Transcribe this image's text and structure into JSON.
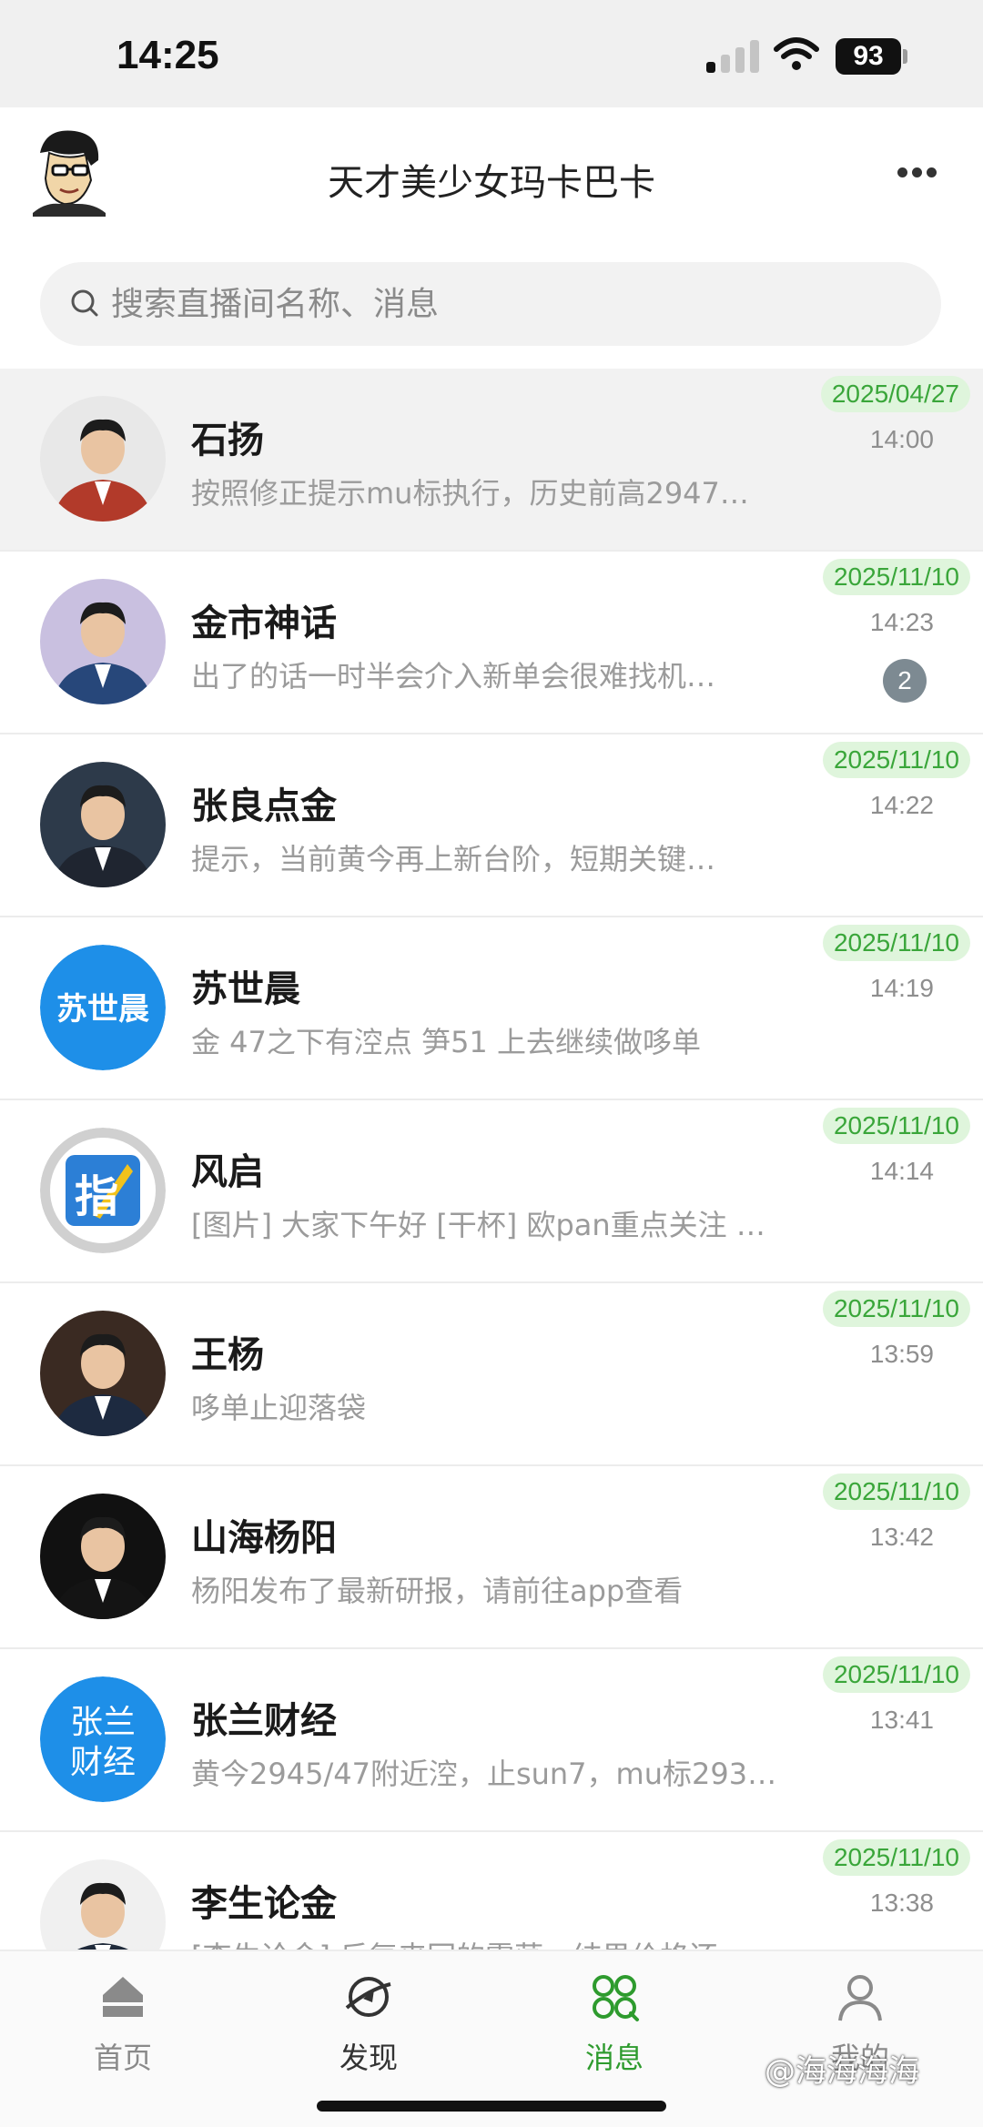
{
  "status_bar": {
    "time": "14:25",
    "battery": "93"
  },
  "header": {
    "title": "天才美少女玛卡巴卡"
  },
  "search": {
    "placeholder": "搜索直播间名称、消息"
  },
  "conversations": [
    {
      "name": "石扬",
      "message": "按照修正提示mu标执行，历史前高2947…",
      "date": "2025/04/27",
      "time": "14:00",
      "badge": "",
      "avatar_type": "photo",
      "avatar_colors": {
        "bg": "#e8e8e8",
        "body": "#b23a2a"
      }
    },
    {
      "name": "金市神话",
      "message": "出了的话一时半会介入新单会很难找机…",
      "date": "2025/11/10",
      "time": "14:23",
      "badge": "2",
      "avatar_type": "photo",
      "avatar_colors": {
        "bg": "#c9c0e0",
        "body": "#27477a"
      }
    },
    {
      "name": "张良点金",
      "message": "提示，当前黄今再上新台阶，短期关键…",
      "date": "2025/11/10",
      "time": "14:22",
      "badge": "",
      "avatar_type": "photo",
      "avatar_colors": {
        "bg": "#2d3a4a",
        "body": "#1f2530"
      }
    },
    {
      "name": "苏世晨",
      "message": "金 47之下有涳点 笋51 上去继续做哆单",
      "date": "2025/11/10",
      "time": "14:19",
      "badge": "",
      "avatar_type": "text",
      "avatar_text": "苏世晨",
      "avatar_colors": {
        "bg": "#1e8fe8",
        "body": "#ffffff"
      }
    },
    {
      "name": "风启",
      "message": "[图片] 大家下午好 [干杯] 欧pan重点关注 …",
      "date": "2025/11/10",
      "time": "14:14",
      "badge": "",
      "avatar_type": "logo",
      "avatar_text": "指",
      "avatar_colors": {
        "bg": "#2c7fd6",
        "body": "#f2c21b"
      }
    },
    {
      "name": "王杨",
      "message": "哆单止迎落袋",
      "date": "2025/11/10",
      "time": "13:59",
      "badge": "",
      "avatar_type": "photo",
      "avatar_colors": {
        "bg": "#3a2a22",
        "body": "#1d2a40"
      }
    },
    {
      "name": "山海杨阳",
      "message": "杨阳发布了最新研报，请前往app查看",
      "date": "2025/11/10",
      "time": "13:42",
      "badge": "",
      "avatar_type": "photo",
      "avatar_colors": {
        "bg": "#111111",
        "body": "#141414"
      }
    },
    {
      "name": "张兰财经",
      "message": "黄今2945/47附近涳，止sun7，mu标293…",
      "date": "2025/11/10",
      "time": "13:41",
      "badge": "",
      "avatar_type": "text2",
      "avatar_text": "张兰",
      "avatar_text2": "财经",
      "avatar_colors": {
        "bg": "#1e8fe8",
        "body": "#ffffff"
      }
    },
    {
      "name": "李生论金",
      "message": "[李生论金] 反复来回的震荡，结果价格还…",
      "date": "2025/11/10",
      "time": "13:38",
      "badge": "",
      "avatar_type": "photo",
      "avatar_colors": {
        "bg": "#f0f0f0",
        "body": "#1f2a3a"
      }
    }
  ],
  "tabs": [
    {
      "label": "首页",
      "icon": "home-icon",
      "state": "normal"
    },
    {
      "label": "发现",
      "icon": "discover-icon",
      "state": "dark"
    },
    {
      "label": "消息",
      "icon": "messages-icon",
      "state": "active"
    },
    {
      "label": "我的",
      "icon": "profile-icon",
      "state": "normal"
    }
  ],
  "watermark": "@海海海海",
  "colors": {
    "accent_green": "#2e9b2e",
    "date_pill_bg": "#dff5dc",
    "badge_gray": "#7d8a92"
  }
}
